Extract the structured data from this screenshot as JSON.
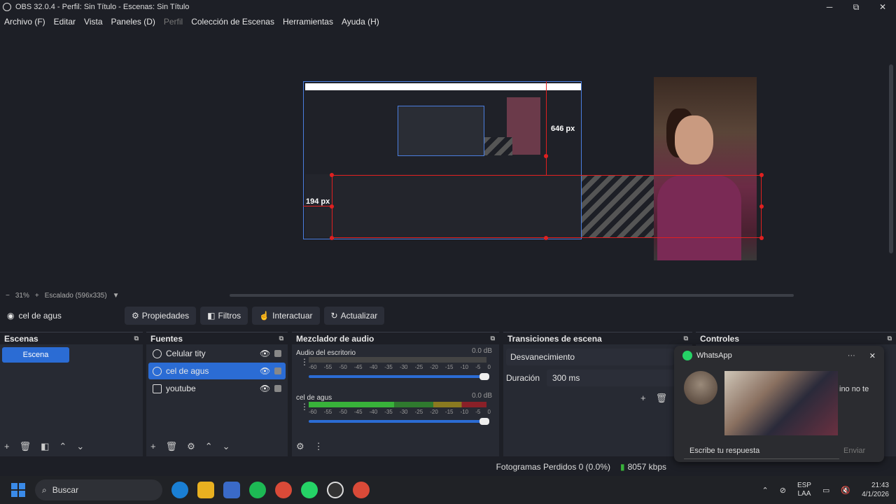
{
  "window": {
    "title": "OBS 32.0.4 - Perfil: Sin Título - Escenas: Sin Título",
    "min": "─",
    "max": "⧉",
    "close": "✕"
  },
  "menu": [
    "Archivo (F)",
    "Editar",
    "Vista",
    "Paneles (D)",
    "Perfil",
    "Colección de Escenas",
    "Herramientas",
    "Ayuda (H)"
  ],
  "preview": {
    "label_646": "646 px",
    "label_194": "194 px"
  },
  "zoom": {
    "minus": "−",
    "level": "31%",
    "plus": "+",
    "scaling": "Escalado (596x335)"
  },
  "source_toolbar": {
    "current": "cel de agus",
    "properties": "Propiedades",
    "filters": "Filtros",
    "interact": "Interactuar",
    "refresh": "Actualizar"
  },
  "docks": {
    "scenes": {
      "title": "Escenas",
      "items": [
        "Escena"
      ]
    },
    "sources": {
      "title": "Fuentes",
      "items": [
        "Celular tity",
        "cel de agus",
        "youtube"
      ]
    },
    "mixer": {
      "title": "Mezclador de audio",
      "tracks": [
        {
          "name": "Audio del escritorio",
          "db": "0.0 dB"
        },
        {
          "name": "cel de agus",
          "db": "0.0 dB"
        }
      ],
      "scale": [
        "-60",
        "-55",
        "-50",
        "-45",
        "-40",
        "-35",
        "-30",
        "-25",
        "-20",
        "-15",
        "-10",
        "-5",
        "0"
      ]
    },
    "transitions": {
      "title": "Transiciones de escena",
      "selected": "Desvanecimiento",
      "duration_label": "Duración",
      "duration": "300 ms"
    },
    "controls": {
      "title": "Controles"
    }
  },
  "status": {
    "dropped": "Fotogramas Perdidos 0 (0.0%)",
    "bitrate": "8057 kbps"
  },
  "whatsapp": {
    "app": "WhatsApp",
    "dots": "···",
    "close": "✕",
    "snippet": "ino no te",
    "reply_placeholder": "Escribe tu respuesta",
    "send": "Enviar"
  },
  "taskbar": {
    "search": "Buscar",
    "lang1": "ESP",
    "lang2": "LAA",
    "time": "21:43",
    "date": "4/1/2026"
  }
}
